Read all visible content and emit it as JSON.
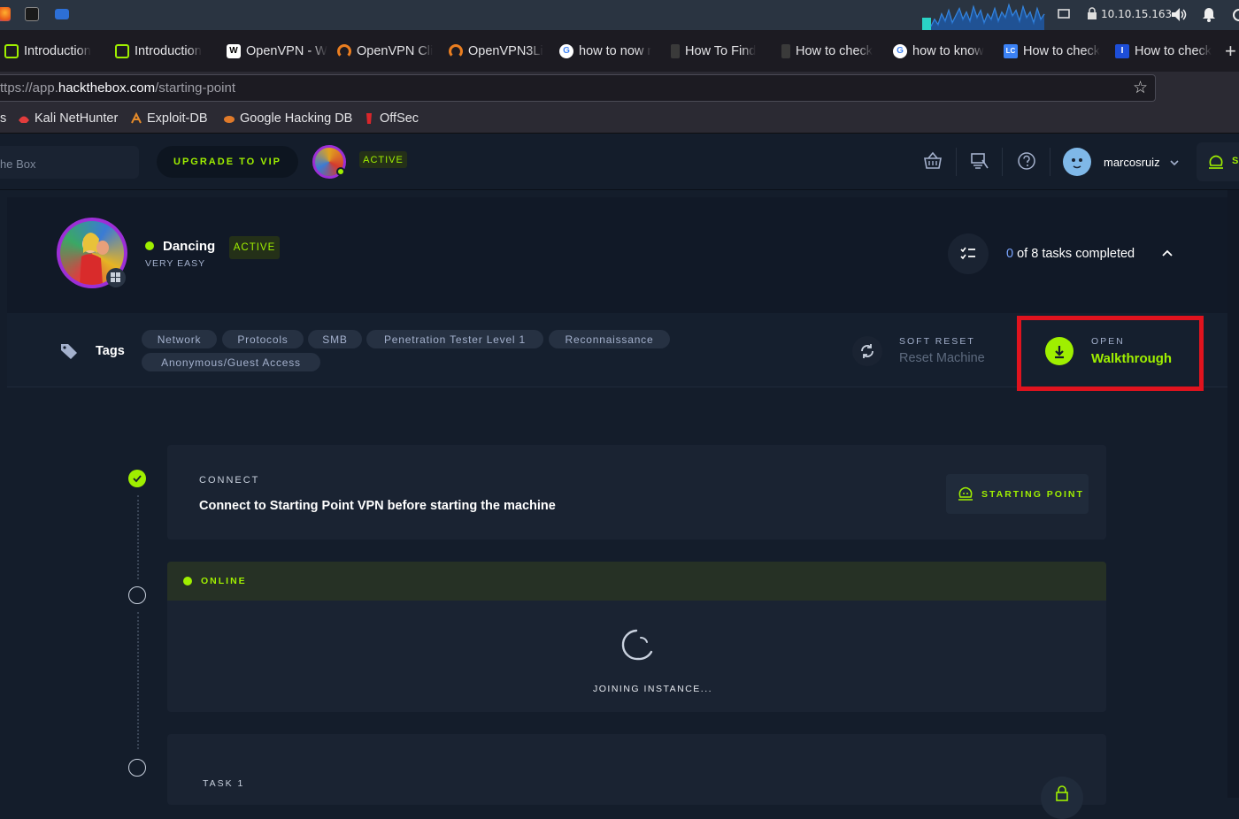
{
  "system_bar": {
    "ip_address": "10.10.15.163",
    "icons": [
      "firefox-icon",
      "terminal-icon",
      "folder-icon",
      "network-graph-icon",
      "screen-icon",
      "lock-icon",
      "volume-icon",
      "bell-icon",
      "power-icon"
    ]
  },
  "tabs": [
    {
      "label": "Introduction",
      "icon": "htb-cube-icon",
      "icon_color": "#9fef00"
    },
    {
      "label": "Introduction",
      "icon": "htb-cube-icon",
      "icon_color": "#9fef00"
    },
    {
      "label": "OpenVPN - W",
      "icon": "wikipedia-icon",
      "icon_color": "#ffffff"
    },
    {
      "label": "OpenVPN Cli",
      "icon": "openvpn-icon",
      "icon_color": "#ea7e20"
    },
    {
      "label": "OpenVPN3Li",
      "icon": "openvpn-icon",
      "icon_color": "#ea7e20"
    },
    {
      "label": "how to now r",
      "icon": "google-icon",
      "icon_color": "#4285f4"
    },
    {
      "label": "How To Find",
      "icon": "kali-dragon-icon",
      "icon_color": "#222222"
    },
    {
      "label": "How to check",
      "icon": "kali-dragon-icon",
      "icon_color": "#222222"
    },
    {
      "label": "how to know",
      "icon": "google-icon",
      "icon_color": "#4285f4"
    },
    {
      "label": "How to check",
      "icon": "lc-icon",
      "icon_color": "#3b82f6"
    },
    {
      "label": "How to check",
      "icon": "i-icon",
      "icon_color": "#1d4ed8"
    }
  ],
  "new_tab_label": "+",
  "url": {
    "prefix": "ttps://app.",
    "domain": "hackthebox.com",
    "path": "/starting-point"
  },
  "bookmarks": [
    {
      "label": "s",
      "icon": ""
    },
    {
      "label": "Kali NetHunter",
      "icon": "nethunter-icon"
    },
    {
      "label": "Exploit-DB",
      "icon": "exploitdb-icon"
    },
    {
      "label": "Google Hacking DB",
      "icon": "ghdb-icon"
    },
    {
      "label": "OffSec",
      "icon": "offsec-icon"
    }
  ],
  "app_header": {
    "search_placeholder": "he Box",
    "upgrade_label": "UPGRADE TO VIP",
    "active_badge": "ACTIVE",
    "username": "marcosruiz"
  },
  "machine": {
    "name": "Dancing",
    "status_badge": "ACTIVE",
    "difficulty": "VERY EASY",
    "tasks_done": "0",
    "tasks_text": "of 8 tasks completed"
  },
  "tags": {
    "label": "Tags",
    "items": [
      "Network",
      "Protocols",
      "SMB",
      "Penetration Tester Level 1",
      "Reconnaissance",
      "Anonymous/Guest Access"
    ]
  },
  "actions": {
    "soft_reset_caption": "SOFT RESET",
    "soft_reset_label": "Reset Machine",
    "walkthrough_caption": "OPEN",
    "walkthrough_label": "Walkthrough"
  },
  "steps": {
    "connect_caption": "CONNECT",
    "connect_text": "Connect to Starting Point VPN before starting the machine",
    "starting_point_label": "STARTING POINT",
    "online_label": "ONLINE",
    "joining_label": "JOINING INSTANCE...",
    "task_caption": "TASK 1"
  },
  "colors": {
    "accent_green": "#9fef00",
    "highlight_red": "#e0131e",
    "bg_dark": "#141d2b",
    "card_bg": "#1a2332"
  }
}
